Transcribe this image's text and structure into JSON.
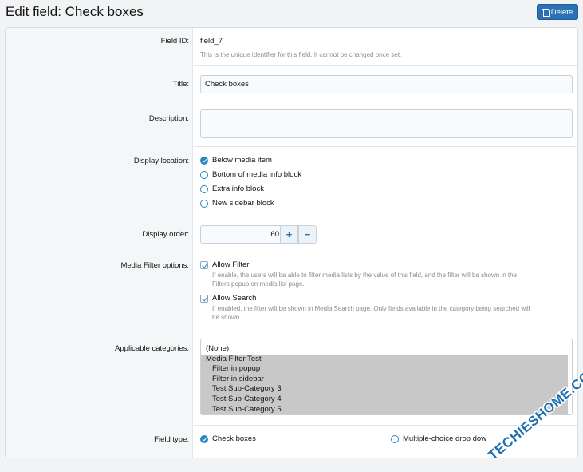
{
  "page": {
    "title": "Edit field: Check boxes",
    "delete_label": "Delete"
  },
  "field_id": {
    "label": "Field ID:",
    "value": "field_7",
    "hint": "This is the unique identifier for this field. It cannot be changed once set."
  },
  "title_field": {
    "label": "Title:",
    "value": "Check boxes"
  },
  "description_field": {
    "label": "Description:",
    "value": ""
  },
  "display_location": {
    "label": "Display location:",
    "options": [
      {
        "label": "Below media item",
        "checked": true
      },
      {
        "label": "Bottom of media info block",
        "checked": false
      },
      {
        "label": "Extra info block",
        "checked": false
      },
      {
        "label": "New sidebar block",
        "checked": false
      }
    ]
  },
  "display_order": {
    "label": "Display order:",
    "value": "60",
    "plus_label": "+",
    "minus_label": "−"
  },
  "media_filter": {
    "label": "Media Filter options:",
    "allow_filter_label": "Allow Filter",
    "allow_filter_hint_1": "If enable, the users will be able to filter media lists by the value of this field, and the filter will be shown in the",
    "allow_filter_hint_2": "Filters popup on media list page.",
    "allow_search_label": "Allow Search",
    "allow_search_hint_1": "If enabled, the filter will be shown in Media Search page. Only fields available in the category being searched will",
    "allow_search_hint_2": "be shown."
  },
  "categories": {
    "label": "Applicable categories:",
    "options": [
      {
        "label": "(None)",
        "selected": false,
        "sub": false
      },
      {
        "label": "Media Filter Test",
        "selected": true,
        "sub": false
      },
      {
        "label": "Filter in popup",
        "selected": true,
        "sub": true
      },
      {
        "label": "Filter in sidebar",
        "selected": true,
        "sub": true
      },
      {
        "label": "Test Sub-Category 3",
        "selected": true,
        "sub": true
      },
      {
        "label": "Test Sub-Category 4",
        "selected": true,
        "sub": true
      },
      {
        "label": "Test Sub-Category 5",
        "selected": true,
        "sub": true
      }
    ]
  },
  "field_type": {
    "label": "Field type:",
    "option_1": "Check boxes",
    "option_2": "Multiple-choice drop dow"
  },
  "watermark": {
    "text": "TECHIESHOME.COM"
  },
  "colors": {
    "accent": "#2a72b5",
    "selected_option": "#c8c8c8"
  }
}
